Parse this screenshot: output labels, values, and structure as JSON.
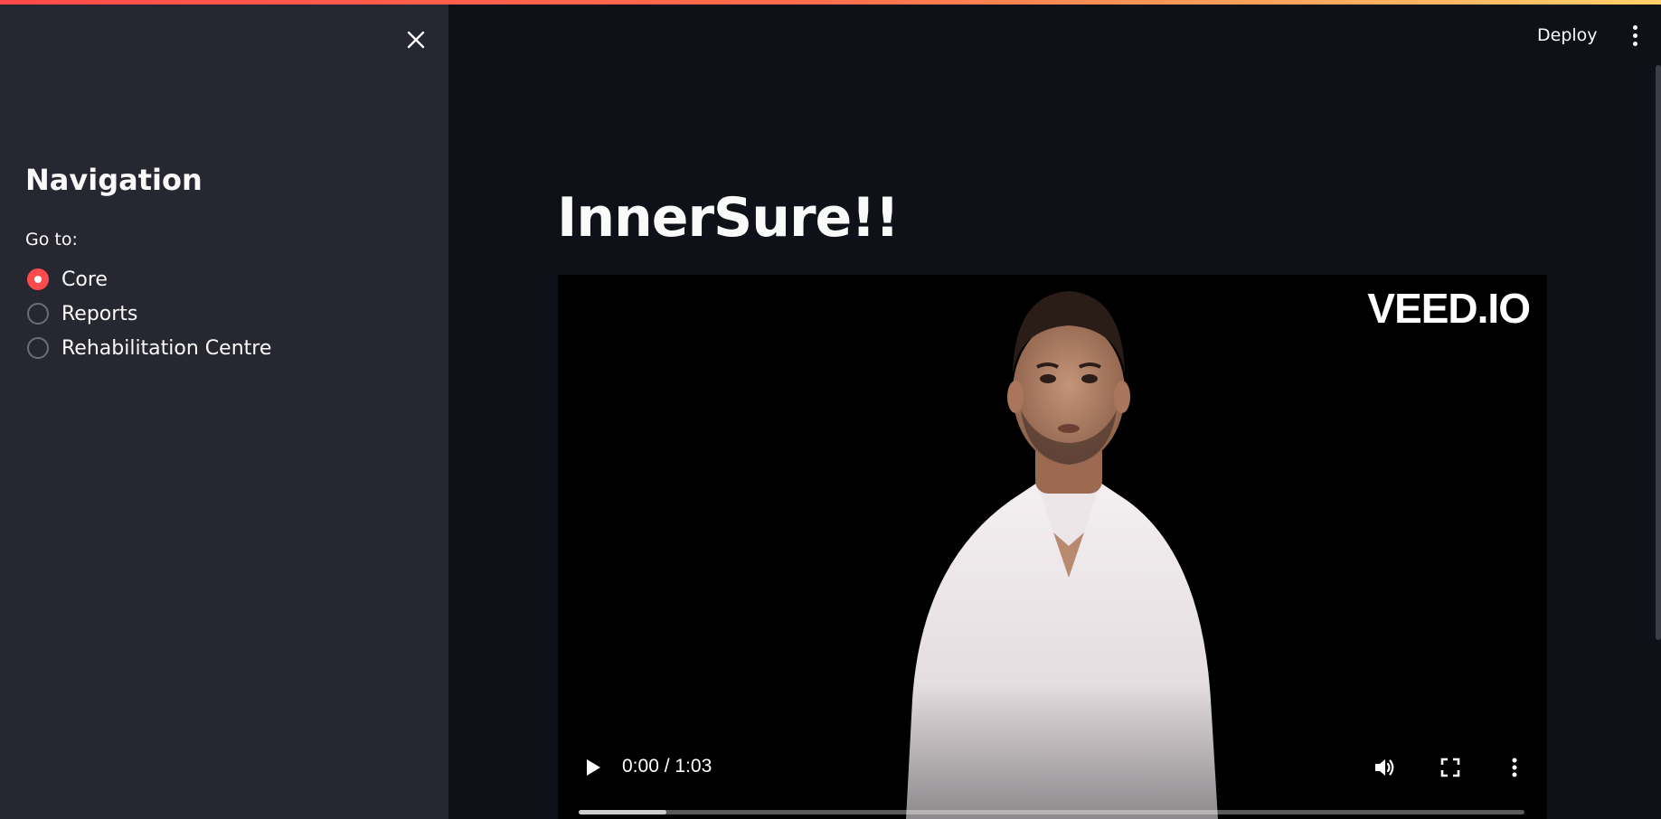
{
  "sidebar": {
    "title": "Navigation",
    "radio_label": "Go to:",
    "options": [
      {
        "label": "Core",
        "selected": true
      },
      {
        "label": "Reports",
        "selected": false
      },
      {
        "label": "Rehabilitation Centre",
        "selected": false
      }
    ]
  },
  "header": {
    "deploy_label": "Deploy"
  },
  "main": {
    "title": "InnerSure!!",
    "video": {
      "watermark": "VEED.IO",
      "time": "0:00 / 1:03",
      "buffered_fraction": 0.093
    }
  },
  "colors": {
    "accent": "#ff4b4b",
    "sidebar_bg": "#262730",
    "main_bg": "#0e1117"
  }
}
